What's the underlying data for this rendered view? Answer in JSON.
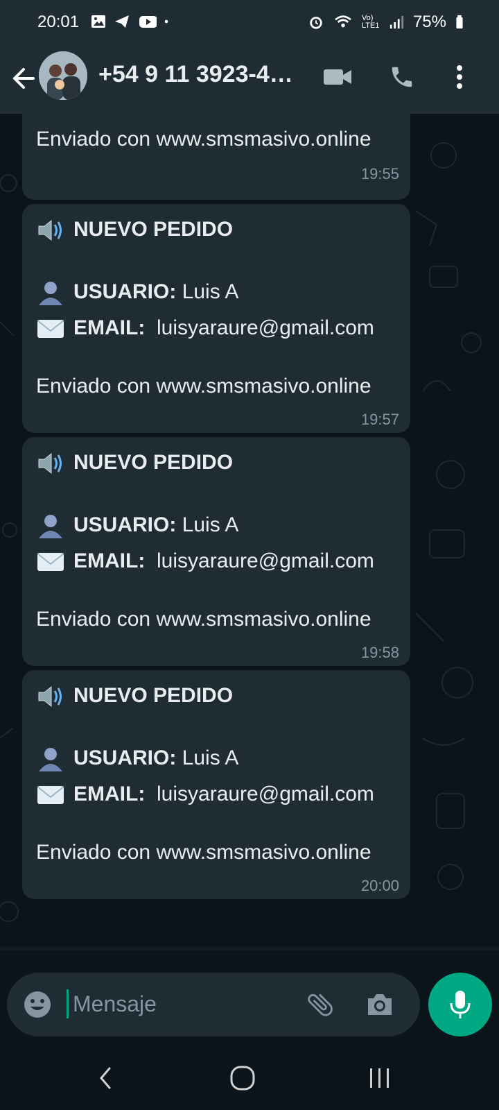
{
  "status": {
    "time": "20:01",
    "battery": "75%",
    "network_label": "Vo) LTE1"
  },
  "header": {
    "contact_name": "+54 9 11 3923-4…"
  },
  "messages": [
    {
      "footer": "Enviado con www.smsmasivo.online",
      "time": "19:55"
    },
    {
      "title": "NUEVO PEDIDO",
      "user_label": "USUARIO:",
      "user_value": "Luis A",
      "email_label": "EMAIL:",
      "email_value": "luisyaraure@gmail.com",
      "footer": "Enviado con www.smsmasivo.online",
      "time": "19:57"
    },
    {
      "title": "NUEVO PEDIDO",
      "user_label": "USUARIO:",
      "user_value": "Luis A",
      "email_label": "EMAIL:",
      "email_value": "luisyaraure@gmail.com",
      "footer": "Enviado con www.smsmasivo.online",
      "time": "19:58"
    },
    {
      "title": "NUEVO PEDIDO",
      "user_label": "USUARIO:",
      "user_value": "Luis A",
      "email_label": "EMAIL:",
      "email_value": "luisyaraure@gmail.com",
      "footer": "Enviado con www.smsmasivo.online",
      "time": "20:00"
    }
  ],
  "composer": {
    "placeholder": "Mensaje"
  },
  "icons": {
    "back": "arrow-left-icon",
    "video": "video-camera-icon",
    "call": "phone-icon",
    "menu": "more-vert-icon",
    "emoji": "smiley-icon",
    "attach": "paperclip-icon",
    "camera": "camera-icon",
    "mic": "microphone-icon",
    "speaker": "speaker-emoji",
    "user": "bust-silhouette-emoji",
    "envelope": "envelope-emoji"
  },
  "colors": {
    "accent": "#00a884",
    "bubble": "#202c33",
    "header": "#1f2c34",
    "background": "#0b141a"
  }
}
